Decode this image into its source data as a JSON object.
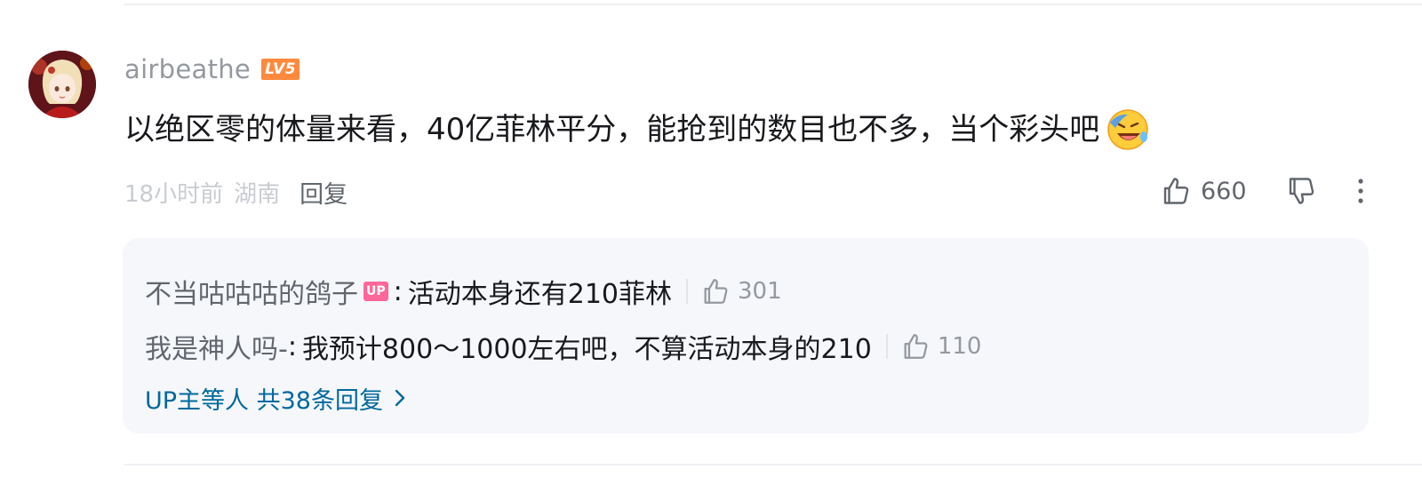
{
  "comment": {
    "username": "airbeathe",
    "level": "LV5",
    "content": "以绝区零的体量来看，40亿菲林平分，能抢到的数目也不多，当个彩头吧",
    "emoji": "laughing-crying-emoji",
    "time": "18小时前",
    "location": "湖南",
    "reply_label": "回复",
    "like_count": "660"
  },
  "sub_replies": {
    "items": [
      {
        "name": "不当咕咕咕的鸽子",
        "badge": "UP",
        "separator": ":",
        "text": "活动本身还有210菲林",
        "like_count": "301"
      },
      {
        "name": "我是神人吗-",
        "separator": ":",
        "text": "我预计800～1000左右吧，不算活动本身的210",
        "like_count": "110"
      }
    ],
    "more_label": "UP主等人 共38条回复"
  },
  "colors": {
    "level_badge": "#ff8a3d",
    "up_badge": "#ff6699",
    "link": "#00699d",
    "sub_bg": "#f6f7fb"
  }
}
